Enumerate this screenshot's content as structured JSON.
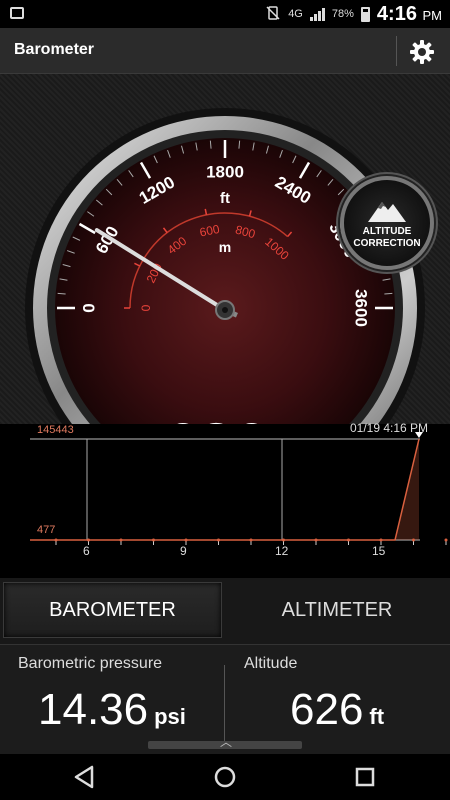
{
  "status": {
    "network": "4G",
    "battery": "78%",
    "time": "4:16",
    "ampm": "PM"
  },
  "app": {
    "title": "Barometer"
  },
  "gauge": {
    "outer_ticks": [
      "0",
      "600",
      "1200",
      "1800",
      "2400",
      "3000",
      "3600"
    ],
    "outer_unit": "ft",
    "inner_ticks": [
      "0",
      "200",
      "400",
      "600",
      "800",
      "1000"
    ],
    "inner_unit": "m",
    "reading_ft": 626,
    "display_value": "626",
    "display_unit": "ft",
    "altitude_correction": "ALTITUDE\nCORRECTION"
  },
  "graph": {
    "max_label": "145443",
    "min_label": "477",
    "timestamp": "01/19 4:16 PM",
    "x_labels": [
      "6",
      "9",
      "12",
      "15"
    ]
  },
  "tabs": {
    "barometer": "BAROMETER",
    "altimeter": "ALTIMETER"
  },
  "info": {
    "pressure_label": "Barometric pressure",
    "pressure_value": "14.36",
    "pressure_unit": "psi",
    "altitude_label": "Altitude",
    "altitude_value": "626",
    "altitude_unit": "ft"
  },
  "colors": {
    "accent": "#e8433a",
    "graph_line": "#d9603f"
  },
  "icons": [
    "settings-gear-icon",
    "mountain-icon",
    "back-icon",
    "home-icon",
    "recents-icon"
  ]
}
